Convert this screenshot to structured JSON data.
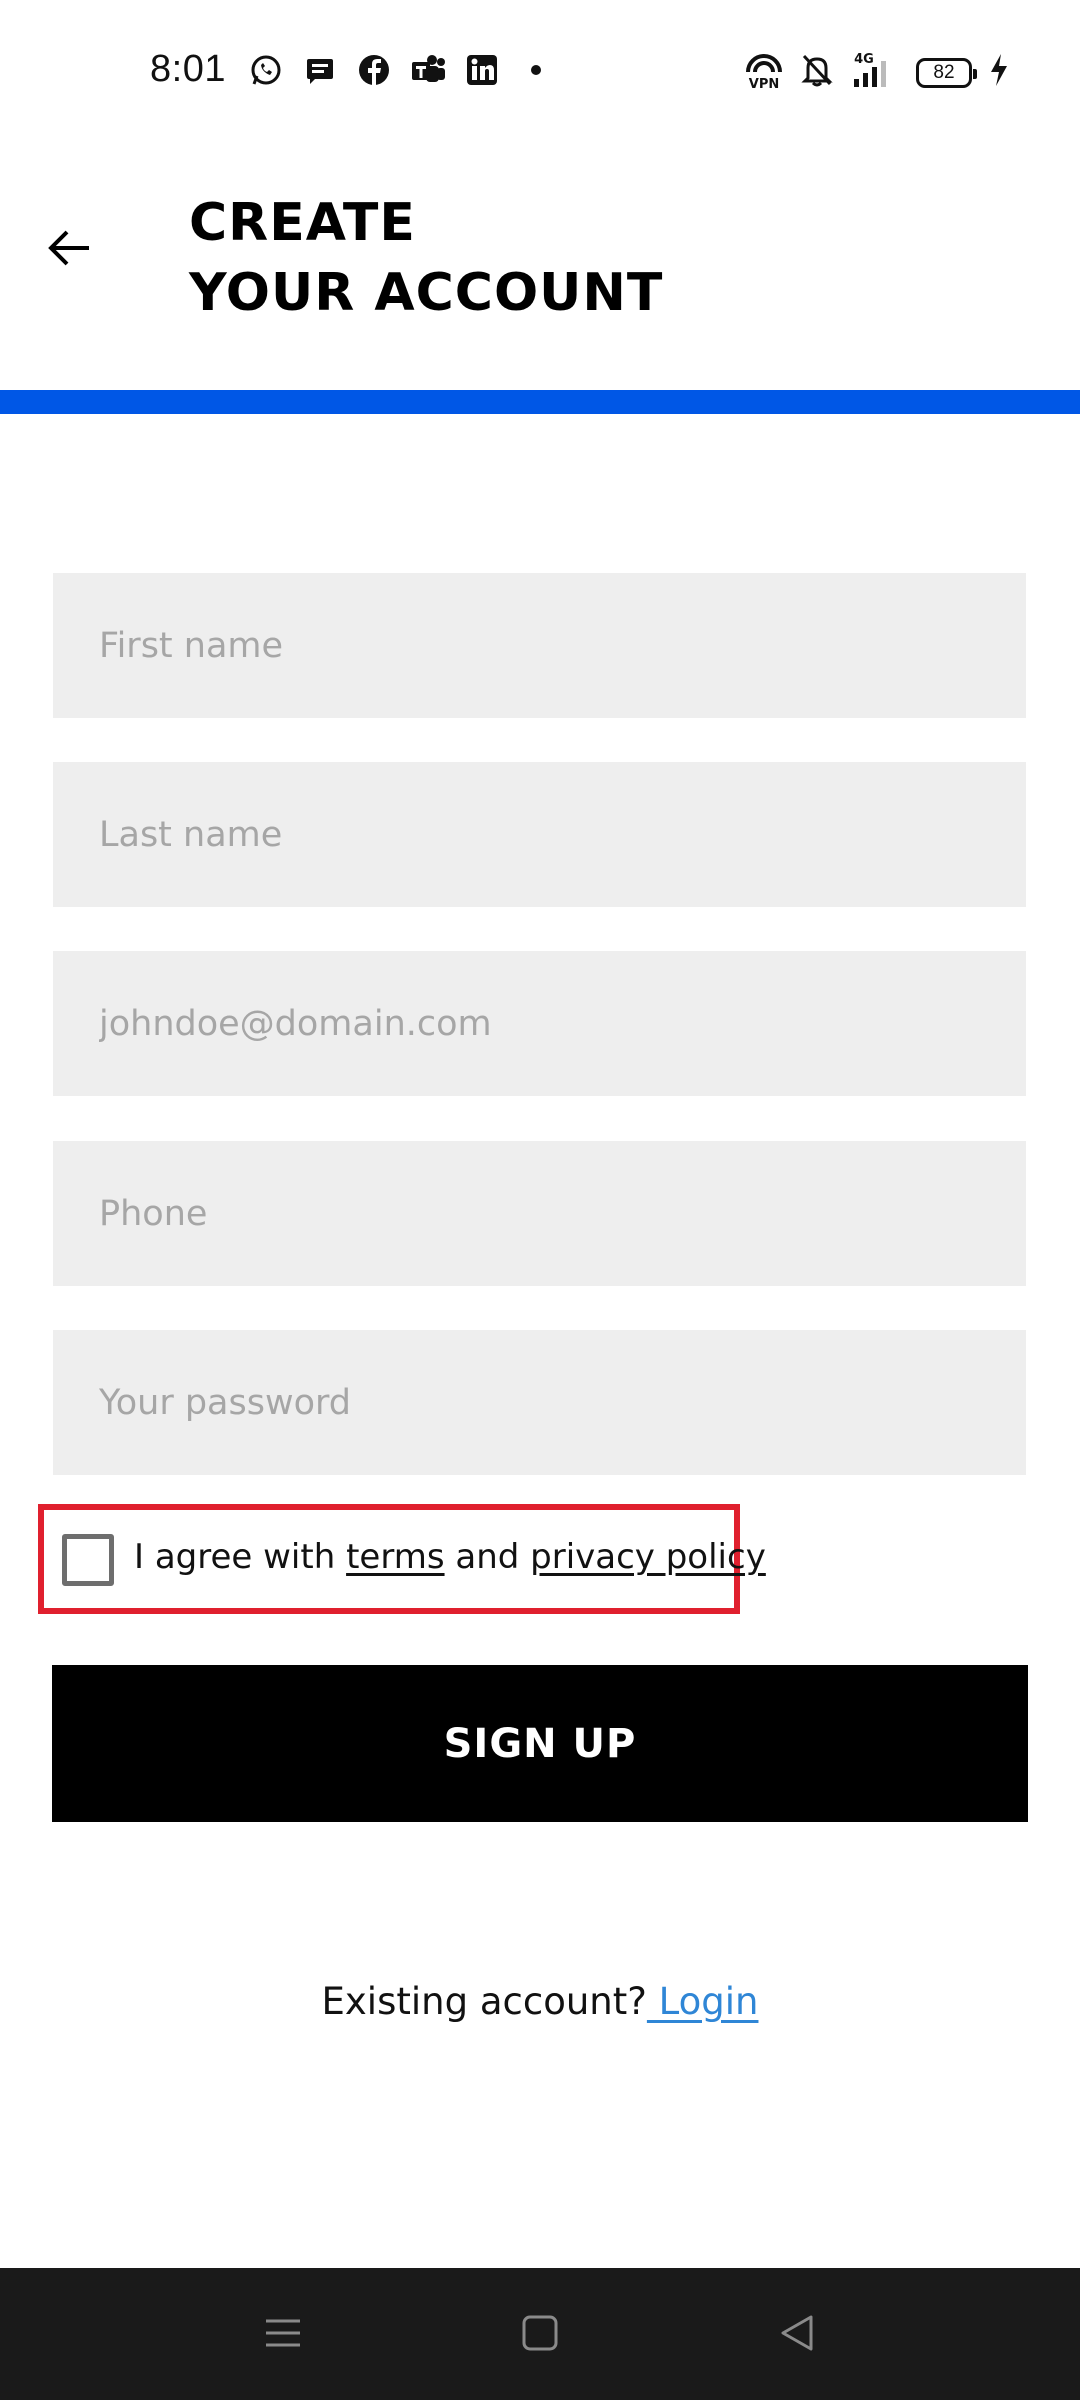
{
  "status_bar": {
    "time": "8:01",
    "notification_icons": [
      "whatsapp-icon",
      "message-icon",
      "facebook-icon",
      "teams-icon",
      "linkedin-icon",
      "dot-icon"
    ],
    "system_icons": [
      "vpn-icon",
      "bell-off-icon",
      "signal-4g-icon",
      "battery-icon",
      "charging-icon"
    ],
    "vpn_label": "VPN",
    "network": "4G",
    "battery": "82"
  },
  "header": {
    "title_line1": "CREATE",
    "title_line2": "YOUR ACCOUNT",
    "progress_color": "#0057e6"
  },
  "form": {
    "first_name": {
      "value": "",
      "placeholder": "First name"
    },
    "last_name": {
      "value": "",
      "placeholder": "Last name"
    },
    "email": {
      "value": "",
      "placeholder": "johndoe@domain.com"
    },
    "phone": {
      "value": "",
      "placeholder": "Phone"
    },
    "password": {
      "value": "",
      "placeholder": "Your password"
    },
    "agree": {
      "checked": false,
      "prefix": "I agree with ",
      "terms_link": "terms",
      "middle": " and ",
      "privacy_link": "privacy policy",
      "highlight_color": "#e0202e"
    },
    "signup_label": "SIGN UP"
  },
  "footer": {
    "existing_text": "Existing account?",
    "login_link": " Login",
    "link_color": "#2f86d6"
  },
  "nav_bar": {
    "buttons": [
      "menu-icon",
      "home-icon",
      "back-icon"
    ]
  }
}
